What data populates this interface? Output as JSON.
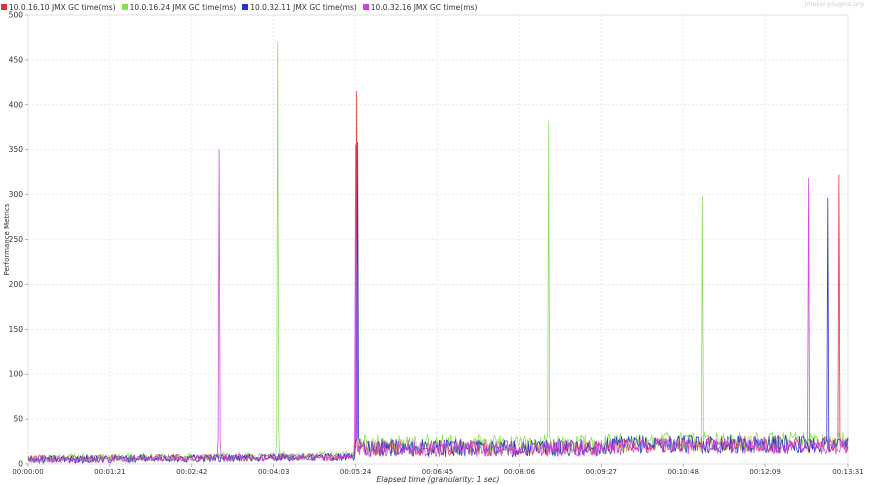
{
  "watermark": "jmeter-plugins.org",
  "chart_data": {
    "type": "line",
    "title": "",
    "xlabel": "Elapsed time (granularity: 1 sec)",
    "ylabel": "Performance Metrics",
    "ylim": [
      0,
      500
    ],
    "y_ticks": [
      0,
      50,
      100,
      150,
      200,
      250,
      300,
      350,
      400,
      450,
      500
    ],
    "xlim": [
      "00:00:00",
      "00:13:31"
    ],
    "x_ticks": [
      "00:00:00",
      "00:01:21",
      "00:02:42",
      "00:04:03",
      "00:05:24",
      "00:06:45",
      "00:08:06",
      "00:09:27",
      "00:10:48",
      "00:12:09",
      "00:13:31"
    ],
    "grid": true,
    "legend_position": "top-left",
    "series": [
      {
        "name": "10.0.16.10 JMX GC time(ms)",
        "color": "#e03030",
        "baseline": [
          [
            0,
            6
          ],
          [
            322,
            8
          ],
          [
            324,
            18
          ],
          [
            560,
            18
          ],
          [
            600,
            22
          ],
          [
            811,
            22
          ]
        ],
        "noise": 9,
        "spikes": [
          {
            "x": "00:05:25",
            "y": 415
          },
          {
            "x": "00:13:22",
            "y": 322
          }
        ]
      },
      {
        "name": "10.0.16.24 JMX GC time(ms)",
        "color": "#88dd55",
        "baseline": [
          [
            0,
            6
          ],
          [
            322,
            10
          ],
          [
            324,
            22
          ],
          [
            560,
            22
          ],
          [
            600,
            25
          ],
          [
            811,
            25
          ]
        ],
        "noise": 11,
        "spikes": [
          {
            "x": "00:04:07",
            "y": 470
          },
          {
            "x": "00:08:35",
            "y": 382
          },
          {
            "x": "00:11:07",
            "y": 298
          }
        ]
      },
      {
        "name": "10.0.32.11 JMX GC time(ms)",
        "color": "#2233cc",
        "baseline": [
          [
            0,
            5
          ],
          [
            322,
            8
          ],
          [
            324,
            18
          ],
          [
            560,
            18
          ],
          [
            600,
            22
          ],
          [
            811,
            22
          ]
        ],
        "noise": 10,
        "spikes": [
          {
            "x": "00:05:26",
            "y": 358
          },
          {
            "x": "00:13:11",
            "y": 296
          }
        ]
      },
      {
        "name": "10.0.32.16 JMX GC time(ms)",
        "color": "#cc44dd",
        "baseline": [
          [
            0,
            5
          ],
          [
            322,
            8
          ],
          [
            324,
            17
          ],
          [
            560,
            17
          ],
          [
            600,
            20
          ],
          [
            811,
            20
          ]
        ],
        "noise": 9,
        "spikes": [
          {
            "x": "00:03:09",
            "y": 350
          },
          {
            "x": "00:05:24",
            "y": 355
          },
          {
            "x": "00:12:52",
            "y": 318
          }
        ]
      }
    ]
  }
}
